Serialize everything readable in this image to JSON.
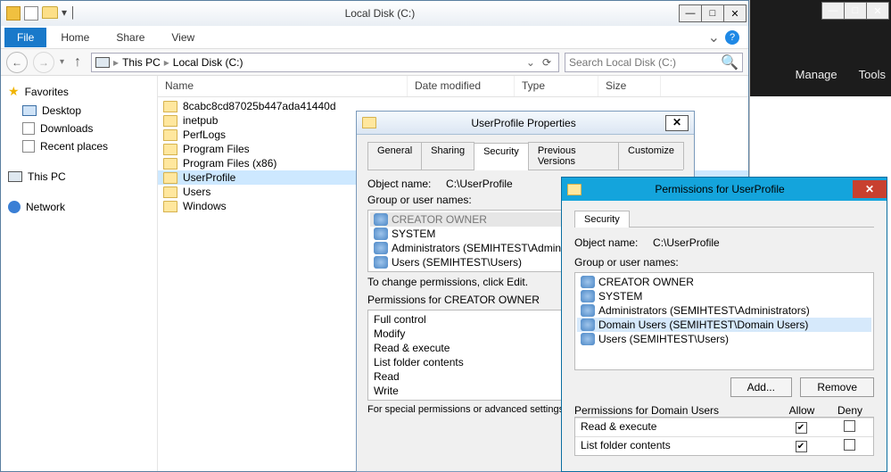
{
  "explorer": {
    "title": "Local Disk (C:)",
    "ribbon": {
      "file": "File",
      "home": "Home",
      "share": "Share",
      "view": "View"
    },
    "breadcrumb": {
      "root_icon": "pc",
      "seg1": "This PC",
      "seg2": "Local Disk (C:)"
    },
    "search_placeholder": "Search Local Disk (C:)",
    "columns": {
      "name": "Name",
      "date": "Date modified",
      "type": "Type",
      "size": "Size"
    },
    "nav": {
      "favorites": "Favorites",
      "desktop": "Desktop",
      "downloads": "Downloads",
      "recent": "Recent places",
      "thispc": "This PC",
      "network": "Network"
    },
    "files": [
      "8cabc8cd87025b447ada41440d",
      "inetpub",
      "PerfLogs",
      "Program Files",
      "Program Files (x86)",
      "UserProfile",
      "Users",
      "Windows"
    ],
    "selected_index": 5
  },
  "props": {
    "title": "UserProfile Properties",
    "tabs": {
      "general": "General",
      "sharing": "Sharing",
      "security": "Security",
      "prev": "Previous Versions",
      "cust": "Customize"
    },
    "object_label": "Object name:",
    "object_value": "C:\\UserProfile",
    "group_label": "Group or user names:",
    "groups": [
      "CREATOR OWNER",
      "SYSTEM",
      "Administrators (SEMIHTEST\\Administrators)",
      "Users (SEMIHTEST\\Users)"
    ],
    "change_hint": "To change permissions, click Edit.",
    "perm_for": "Permissions for CREATOR OWNER",
    "perms": [
      "Full control",
      "Modify",
      "Read & execute",
      "List folder contents",
      "Read",
      "Write"
    ],
    "advanced_hint": "For special permissions or advanced settings, click Advanced."
  },
  "perms": {
    "title": "Permissions for UserProfile",
    "tab_security": "Security",
    "object_label": "Object name:",
    "object_value": "C:\\UserProfile",
    "group_label": "Group or user names:",
    "groups": [
      "CREATOR OWNER",
      "SYSTEM",
      "Administrators (SEMIHTEST\\Administrators)",
      "Domain Users (SEMIHTEST\\Domain Users)",
      "Users (SEMIHTEST\\Users)"
    ],
    "selected_group_index": 3,
    "add_btn": "Add...",
    "remove_btn": "Remove",
    "perm_for": "Permissions for Domain Users",
    "allow": "Allow",
    "deny": "Deny",
    "rows": [
      {
        "name": "Read & execute",
        "allow": true,
        "deny": false
      },
      {
        "name": "List folder contents",
        "allow": true,
        "deny": false
      }
    ]
  },
  "bgwin": {
    "manage": "Manage",
    "tools": "Tools"
  }
}
